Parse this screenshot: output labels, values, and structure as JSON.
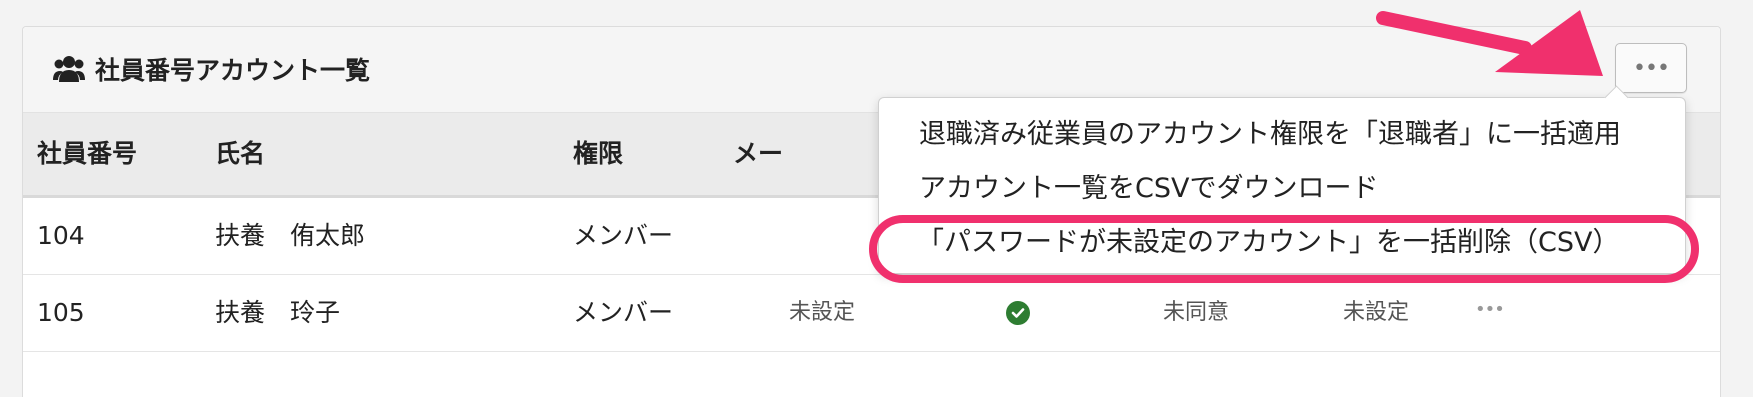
{
  "panel": {
    "title": "社員番号アカウント一覧",
    "title_icon": "users-icon",
    "more_button_icon": "ellipsis-icon",
    "more_button_label": "•••"
  },
  "table": {
    "headers": [
      "社員番号",
      "氏名",
      "権限",
      "メー"
    ],
    "rows": [
      {
        "id": "104",
        "name": "扶養　侑太郎",
        "role": "メンバー"
      },
      {
        "id": "105",
        "name": "扶養　玲子",
        "role": "メンバー",
        "email_status": "未設定",
        "verified_icon": "check-circle-icon",
        "agreement": "未同意",
        "password": "未設定",
        "more_label": "•••"
      }
    ]
  },
  "dropdown": {
    "items": [
      "退職済み従業員のアカウント権限を「退職者」に一括適用",
      "アカウント一覧をCSVでダウンロード",
      "「パスワードが未設定のアカウント」を一括削除（CSV）"
    ]
  },
  "colors": {
    "annotation": "#f0306d",
    "check": "#2e7d32",
    "header_bg": "#ebebeb"
  }
}
